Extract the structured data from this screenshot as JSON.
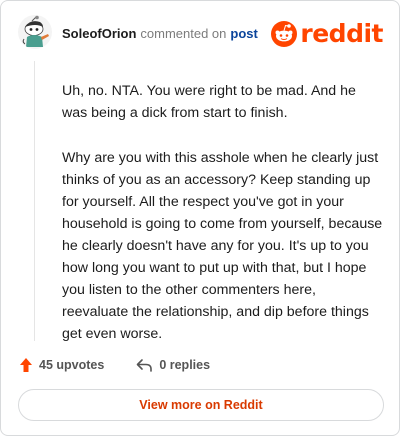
{
  "comment": {
    "author": "SoleofOrion",
    "action_text": "commented on",
    "post_link": "post",
    "paragraphs": [
      "Uh, no. NTA. You were right to be mad. And he was being a dick from start to finish.",
      "Why are you with this asshole when he clearly just thinks of you as an accessory? Keep standing up for yourself. All the respect you've got in your household is going to come from yourself, because he clearly doesn't have any for you. It's up to you how long you want to put up with that, but I hope you listen to the other commenters here, reevaluate the relationship, and dip before things get even worse."
    ]
  },
  "brand": {
    "wordmark": "reddit",
    "color": "#ff4500"
  },
  "actions": {
    "upvotes_label": "45 upvotes",
    "replies_label": "0 replies"
  },
  "footer": {
    "view_more_label": "View more on Reddit",
    "color": "#d93a00"
  },
  "icons": {
    "avatar": "snoo-avatar-icon",
    "logo": "reddit-snoo-icon",
    "upvote": "upvote-arrow-icon",
    "reply": "reply-arrow-icon"
  }
}
